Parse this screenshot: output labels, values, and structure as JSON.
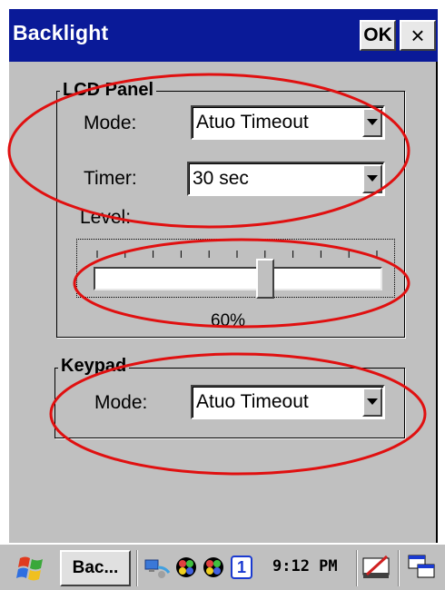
{
  "window": {
    "title": "Backlight",
    "ok_label": "OK",
    "close_label": "×"
  },
  "lcd_panel": {
    "group_label": "LCD Panel",
    "mode_label": "Mode:",
    "mode_value": "Atuo Timeout",
    "timer_label": "Timer:",
    "timer_value": "30 sec",
    "level_label": "Level:",
    "level_value": "60%",
    "level_fraction": 0.6
  },
  "keypad": {
    "group_label": "Keypad",
    "mode_label": "Mode:",
    "mode_value": "Atuo Timeout"
  },
  "taskbar": {
    "task_label": "Bac...",
    "clock": "9:12 PM",
    "tray_badge": "1"
  },
  "colors": {
    "titlebar": "#0a1a98",
    "dialog_bg": "#c0c0c0",
    "highlight_ovals": "#e01010"
  }
}
